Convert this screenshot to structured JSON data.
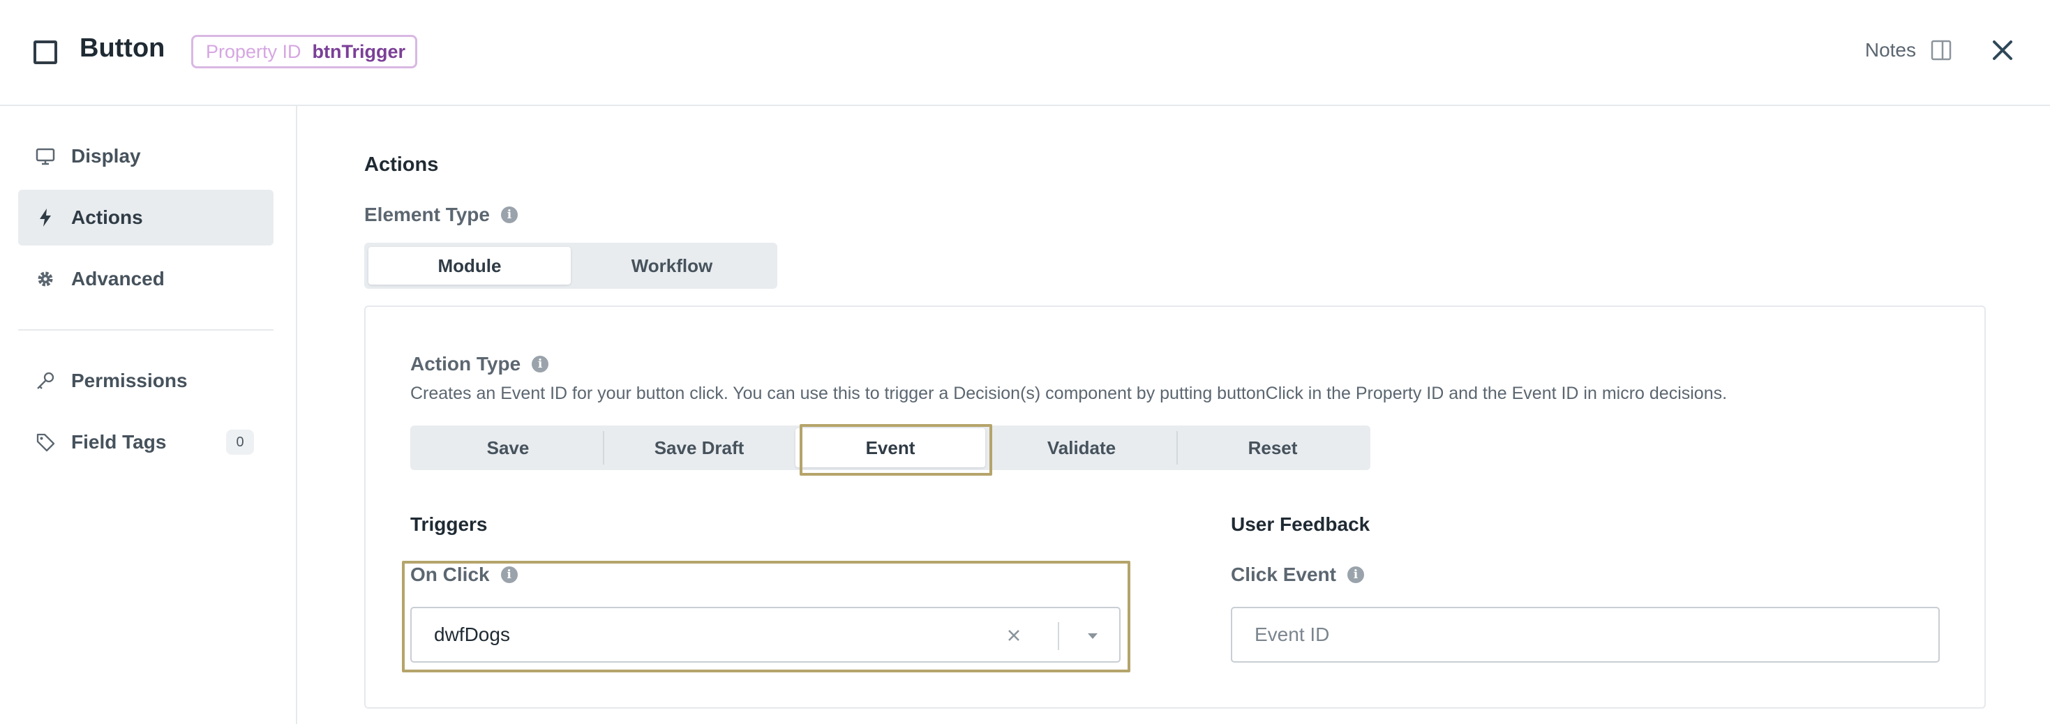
{
  "header": {
    "title": "Button",
    "property_id_label": "Property ID",
    "property_id_value": "btnTrigger",
    "notes_label": "Notes"
  },
  "sidebar": {
    "items": [
      {
        "label": "Display",
        "icon": "monitor-icon",
        "active": false
      },
      {
        "label": "Actions",
        "icon": "lightning-icon",
        "active": true
      },
      {
        "label": "Advanced",
        "icon": "gear-icon",
        "active": false
      },
      {
        "label": "Permissions",
        "icon": "key-icon",
        "active": false
      },
      {
        "label": "Field Tags",
        "icon": "tag-icon",
        "active": false,
        "count": "0"
      }
    ]
  },
  "main": {
    "section_title": "Actions",
    "element_type": {
      "label": "Element Type",
      "options": [
        "Module",
        "Workflow"
      ],
      "selected": "Module"
    },
    "action_type": {
      "label": "Action Type",
      "description": "Creates an Event ID for your button click. You can use this to trigger a Decision(s) component by putting buttonClick in the Property ID and the Event ID in micro decisions.",
      "options": [
        "Save",
        "Save Draft",
        "Event",
        "Validate",
        "Reset"
      ],
      "selected": "Event"
    },
    "triggers": {
      "title": "Triggers",
      "on_click_label": "On Click",
      "on_click_value": "dwfDogs"
    },
    "user_feedback": {
      "title": "User Feedback",
      "click_event_label": "Click Event",
      "click_event_placeholder": "Event ID",
      "click_event_value": ""
    }
  },
  "colors": {
    "highlight": "#b5a46a",
    "property_badge_border": "#d9b8e3",
    "property_value": "#7b3f97",
    "active_bg": "#e8ecef"
  }
}
